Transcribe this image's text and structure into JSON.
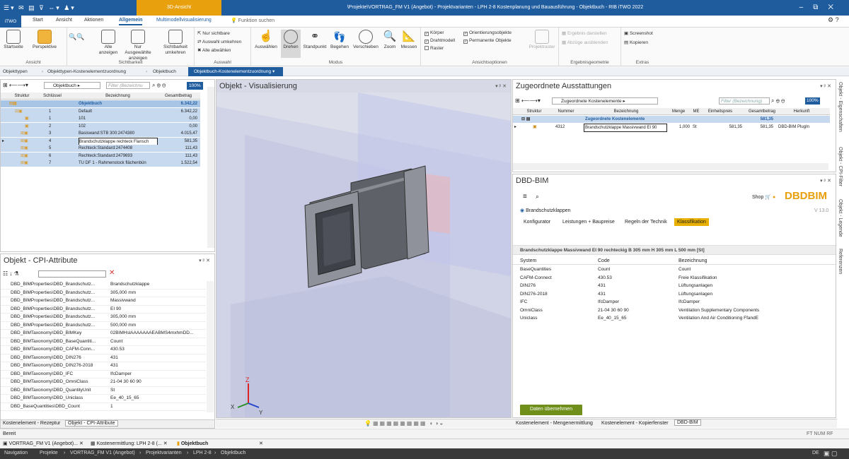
{
  "titlebar": {
    "context_tab": "3D-Ansicht",
    "title": "\\Projekte\\VORTRAG_FM V1 (Angebot) - Projektvarianten - LPH 2-8 Kostenplanung und Bauausführung - Objektbuch - RIB iTWO 2022"
  },
  "menu": {
    "itwo": "iTWO",
    "start": "Start",
    "ansicht": "Ansicht",
    "aktionen": "Aktionen",
    "allgemein": "Allgemein",
    "multimodell": "Multimodellvisualisierung",
    "search": "Funktion suchen"
  },
  "ribbon": {
    "ansicht": {
      "label": "Ansicht",
      "startseite": "Startseite",
      "perspektive": "Perspektive"
    },
    "sichtbarkeit": {
      "label": "Sichtbarkeit",
      "alle": "Alle anzeigen",
      "nur_ausgewaehlte": "Nur Ausgewählte anzeigen",
      "umkehren": "Sichtbarkeit umkehren"
    },
    "auswahl": {
      "label": "Auswahl",
      "nur_sichtbare": "Nur sichtbare",
      "auswahl_umkehren": "Auswahl umkehren",
      "alle_abwaehlen": "Alle abwählen"
    },
    "modus": {
      "label": "Modus",
      "auswaehlen": "Auswählen",
      "drehen": "Drehen",
      "standpunkt": "Standpunkt",
      "begehen": "Begehen",
      "verschieben": "Verschieben",
      "zoom": "Zoom",
      "messen": "Messen"
    },
    "ansichtsoptionen": {
      "label": "Ansichtsoptionen",
      "koerper": "Körper",
      "drahtmodell": "Drahtmodell",
      "raster": "Raster",
      "orientierung": "Orientierungsobjekte",
      "permanente": "Permanente Objekte",
      "projektraster": "Projektraster"
    },
    "ergebnis": {
      "label": "Ergebnisgeometrie",
      "darstellen": "Ergebnis darstellen",
      "abzuege": "Abzüge ausblenden"
    },
    "extras": {
      "label": "Extras",
      "screenshot": "Screenshot",
      "kopieren": "Kopieren"
    }
  },
  "breadcrumb": [
    "Objekttypen",
    "Objekttypen-Kostenelementzuordnung",
    "Objektbuch",
    "Objektbuch-Kostenelementzuordnung"
  ],
  "tree": {
    "dropdown": "Objektbuch",
    "filter": "Filter (Bezeichnu",
    "zoom": "100%",
    "headers": [
      "Struktur",
      "Schlüssel",
      "Bezeichnung",
      "Gesamtbetrag"
    ],
    "rows": [
      {
        "key": "",
        "name": "Objektbuch",
        "amount": "6.342,22"
      },
      {
        "key": "1",
        "name": "Default",
        "amount": "6.342,22"
      },
      {
        "key": "1",
        "name": "101",
        "amount": "0,00"
      },
      {
        "key": "2",
        "name": "102",
        "amount": "0,00"
      },
      {
        "key": "3",
        "name": "Basiswand:STB 300:2474380",
        "amount": "4.015,47"
      },
      {
        "key": "4",
        "name": "Brandschutzklappe rechteck Flansch",
        "amount": "581,35"
      },
      {
        "key": "5",
        "name": "Rechteck:Standard:2474408",
        "amount": "111,43"
      },
      {
        "key": "6",
        "name": "Rechteck:Standard:2479693",
        "amount": "111,43"
      },
      {
        "key": "7",
        "name": "TU DF 1 - Rahmenstock flächenbün",
        "amount": "1.522,54"
      }
    ]
  },
  "attributes": {
    "title": "Objekt - CPI-Attribute",
    "rows": [
      [
        "DBD_BIMProperties\\DBD_Brandschutz...",
        "Brandschutzklappe"
      ],
      [
        "DBD_BIMProperties\\DBD_Brandschutz...",
        "305,000 mm"
      ],
      [
        "DBD_BIMProperties\\DBD_Brandschutz...",
        "Massivwand"
      ],
      [
        "DBD_BIMProperties\\DBD_Brandschutz...",
        "EI 90"
      ],
      [
        "DBD_BIMProperties\\DBD_Brandschutz...",
        "305,000 mm"
      ],
      [
        "DBD_BIMProperties\\DBD_Brandschutz...",
        "500,000 mm"
      ],
      [
        "DBD_BIMTaxonomy\\DBD_BIMKey",
        "02BIMHslAAAAAAAEABMS4mxhmDD..."
      ],
      [
        "DBD_BIMTaxonomy\\DBD_BaseQuantiti...",
        "Count"
      ],
      [
        "DBD_BIMTaxonomy\\DBD_CAFM-Conn...",
        "430.53"
      ],
      [
        "DBD_BIMTaxonomy\\DBD_DIN276",
        "431"
      ],
      [
        "DBD_BIMTaxonomy\\DBD_DIN276-2018",
        "431"
      ],
      [
        "DBD_BIMTaxonomy\\DBD_IFC",
        "IfcDamper"
      ],
      [
        "DBD_BIMTaxonomy\\DBD_OmniClass",
        "21-04 30 60 90"
      ],
      [
        "DBD_BIMTaxonomy\\DBD_QuantityUnit",
        "St"
      ],
      [
        "DBD_BIMTaxonomy\\DBD_Uniclass",
        "Ee_40_15_65"
      ],
      [
        "DBD_BaseQuantities\\DBD_Count",
        "1"
      ]
    ],
    "tab1": "Kostenelement - Rezeptur",
    "tab2": "Objekt - CPI-Attribute"
  },
  "viewer": {
    "title": "Objekt - Visualisierung"
  },
  "ausstattungen": {
    "title": "Zugeordnete Ausstattungen",
    "dropdown": "Zugeordnete Kostenelemente",
    "filter": "Filter (Bezeichnung)",
    "zoom": "100%",
    "headers": [
      "Struktur",
      "Nummer",
      "Bezeichnung",
      "Menge",
      "ME",
      "Einheitspreis",
      "Gesamtbetrag",
      "Herkunft"
    ],
    "root": {
      "name": "Zugeordnete Kostenelemente",
      "total": "581,35"
    },
    "item": {
      "nummer": "4312",
      "name": "Brandschutzklappe Massivwand EI 90",
      "menge": "1,000",
      "me": "St",
      "ep": "581,35",
      "gb": "581,35",
      "herkunft": "DBD-BIM PlugIn"
    }
  },
  "dbd": {
    "title": "DBD-BIM",
    "shop": "Shop",
    "brand": "DBDBIM",
    "radio": "Brandschutzklappen",
    "version": "V 13.0",
    "tabs": [
      "Konfigurator",
      "Leistungen + Baupreise",
      "Regeln der Technik",
      "Klassifikation"
    ],
    "heading": "Brandschutzklappe Massivwand EI 90 rechteckig B 305 mm H 305 mm L 500 mm [St]",
    "headers": [
      "System",
      "Code",
      "Bezeichnung"
    ],
    "rows": [
      [
        "BaseQuantities",
        "Count",
        "Count"
      ],
      [
        "CAFM-Connect",
        "430.53",
        "Freie Klassifikation"
      ],
      [
        "DIN276",
        "431",
        "Lüftungsanlagen"
      ],
      [
        "DIN276-2018",
        "431",
        "Lüftungsanlagen"
      ],
      [
        "IFC",
        "IfcDamper",
        "IfcDamper"
      ],
      [
        "OmniClass",
        "21-04 30 60 90",
        "Ventilation Supplementary Components"
      ],
      [
        "Uniclass",
        "Ee_40_15_65",
        "Ventilation And Air Conditioning FfandE"
      ]
    ],
    "button": "Daten übernehmen",
    "bottom_tabs": [
      "Kostenelement - Mengenermittlung",
      "Kostenelement - Kopierfenster",
      "DBD-BIM"
    ]
  },
  "side_tabs": [
    "Objekt - Eigenschaften",
    "Objekt - CPI-Filter",
    "Objekt - Legende",
    "Referenzen"
  ],
  "status": {
    "left": "Bereit",
    "right": "FT NUM RF"
  },
  "doc_tabs": [
    "VORTRAG_FM V1 (Angebot)...",
    "Kostenermittlung: LPH 2-8 (...",
    "Objektbuch"
  ],
  "nav": {
    "items": [
      "Navigation",
      "Projekte",
      "VORTRAG_FM V1 (Angebot)",
      "Projektvarianten",
      "LPH 2-8",
      "Objektbuch"
    ],
    "lang": "DE"
  },
  "colors": {
    "brand": "#1f5c9e",
    "accent": "#e8a00c",
    "select": "#c6d9ef",
    "green": "#6f8f1a"
  }
}
